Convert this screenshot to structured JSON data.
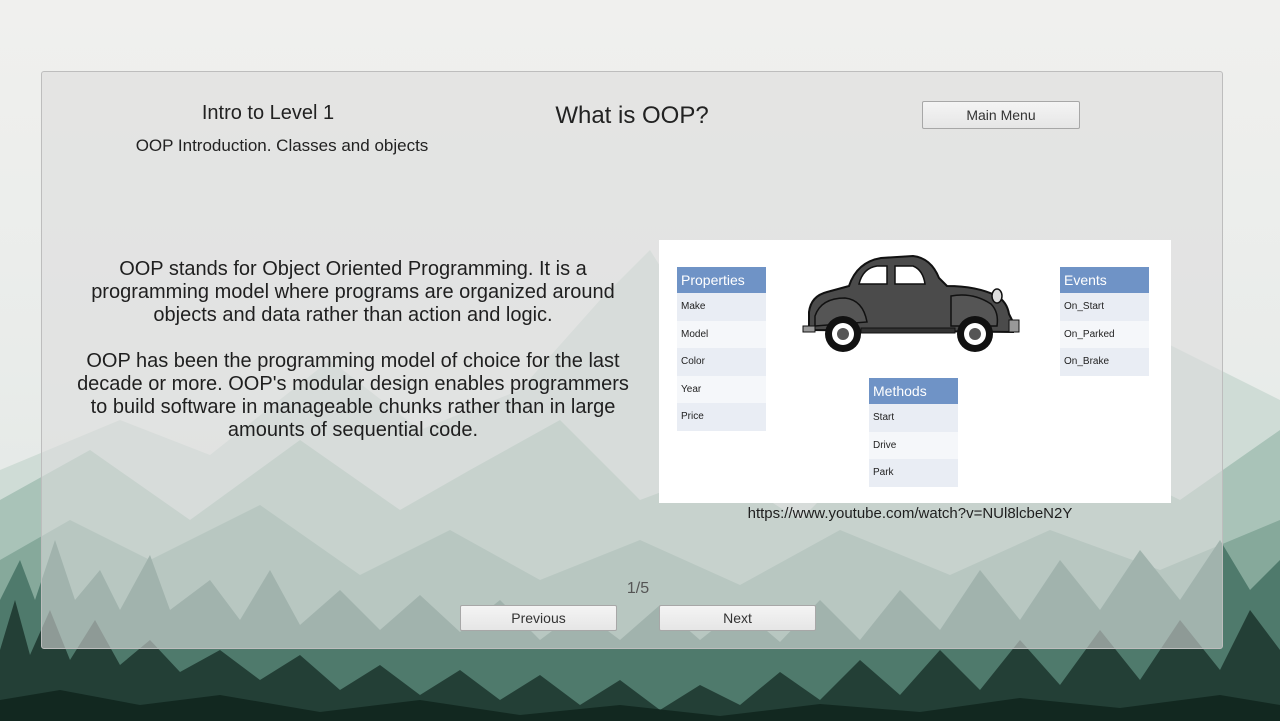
{
  "header": {
    "level_title": "Intro to Level 1",
    "lesson_title": "OOP Introduction. Classes and objects",
    "page_title": "What is OOP?",
    "main_menu_label": "Main Menu"
  },
  "content": {
    "paragraphs": [
      "OOP stands for Object Oriented Programming. It is a programming model where programs are organized around objects and data rather than action and logic.",
      "OOP has been the programming model of choice for the last decade or more. OOP's modular design enables programmers to build software in manageable chunks rather than in large amounts of sequential code."
    ]
  },
  "diagram": {
    "properties": {
      "header": "Properties",
      "items": [
        "Make",
        "Model",
        "Color",
        "Year",
        "Price"
      ]
    },
    "methods": {
      "header": "Methods",
      "items": [
        "Start",
        "Drive",
        "Park"
      ]
    },
    "events": {
      "header": "Events",
      "items": [
        "On_Start",
        "On_Parked",
        "On_Brake"
      ]
    },
    "header_color": "#6f93c6"
  },
  "video_url": "https://www.youtube.com/watch?v=NUl8lcbeN2Y",
  "pagination": {
    "counter": "1/5",
    "previous_label": "Previous",
    "next_label": "Next"
  },
  "icons": {
    "car": "car-icon",
    "background": "mountain-forest-background"
  }
}
